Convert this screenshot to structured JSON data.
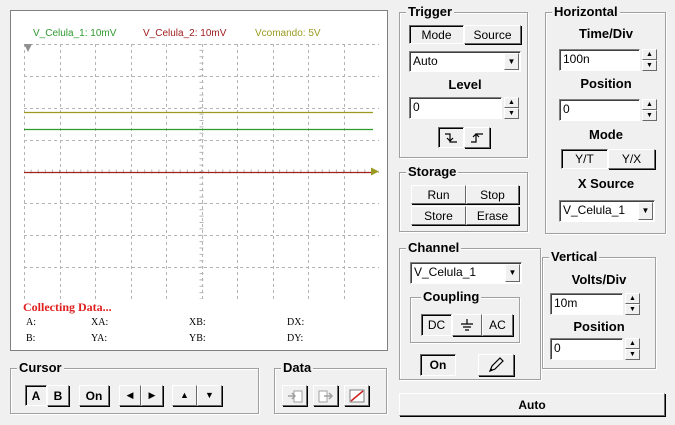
{
  "scope": {
    "legend": [
      {
        "text": "V_Celula_1: 10mV",
        "color": "#2f9a2f"
      },
      {
        "text": "V_Celula_2: 10mV",
        "color": "#a02020"
      },
      {
        "text": "Vcomando: 5V",
        "color": "#9a9a20"
      }
    ],
    "traces": [
      {
        "name": "Vcomando",
        "color": "#9a9a20",
        "level": 0.265
      },
      {
        "name": "V_Celula_1",
        "color": "#2f9a2f",
        "level": 0.335
      },
      {
        "name": "V_Celula_2",
        "color": "#a02020",
        "level": 0.5
      }
    ],
    "status_text": "Collecting Data...",
    "readouts": {
      "a": "A:",
      "xa": "XA:",
      "xb": "XB:",
      "dx": "DX:",
      "b": "B:",
      "ya": "YA:",
      "yb": "YB:",
      "dy": "DY:"
    }
  },
  "trigger": {
    "title": "Trigger",
    "mode_label": "Mode",
    "source_label": "Source",
    "mode_value": "Auto",
    "level_label": "Level",
    "level_value": "0"
  },
  "horizontal": {
    "title": "Horizontal",
    "time_div_label": "Time/Div",
    "time_div_value": "100n",
    "position_label": "Position",
    "position_value": "0",
    "mode_label": "Mode",
    "yt_label": "Y/T",
    "yx_label": "Y/X",
    "x_source_label": "X Source",
    "x_source_value": "V_Celula_1"
  },
  "storage": {
    "title": "Storage",
    "run_label": "Run",
    "stop_label": "Stop",
    "store_label": "Store",
    "erase_label": "Erase"
  },
  "channel": {
    "title": "Channel",
    "channel_value": "V_Celula_1",
    "coupling_title": "Coupling",
    "dc_label": "DC",
    "ac_label": "AC",
    "on_label": "On"
  },
  "vertical": {
    "title": "Vertical",
    "volts_div_label": "Volts/Div",
    "volts_div_value": "10m",
    "position_label": "Position",
    "position_value": "0"
  },
  "cursor": {
    "title": "Cursor",
    "a_label": "A",
    "b_label": "B",
    "on_label": "On"
  },
  "data_panel": {
    "title": "Data"
  },
  "auto_label": "Auto"
}
